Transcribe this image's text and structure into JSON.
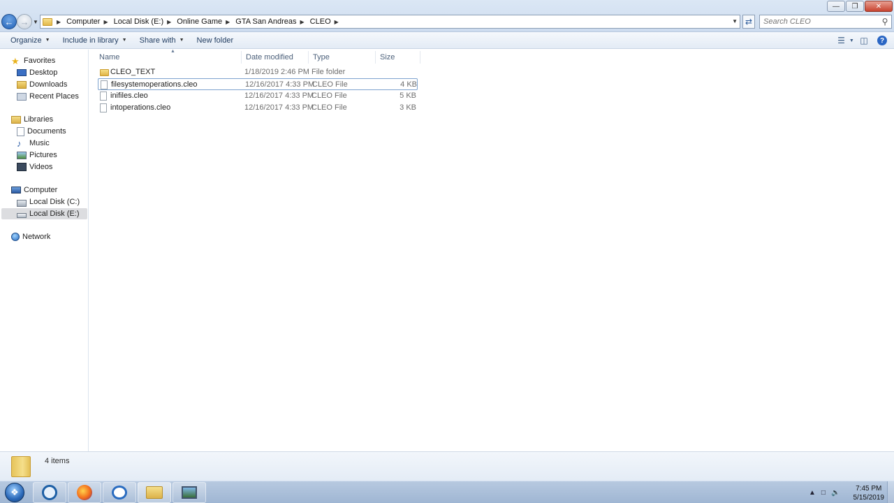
{
  "address": {
    "crumbs": [
      "Computer",
      "Local Disk (E:)",
      "Online Game",
      "GTA San Andreas",
      "CLEO"
    ]
  },
  "search": {
    "placeholder": "Search CLEO"
  },
  "toolbar": {
    "organize": "Organize",
    "include_in_library": "Include in library",
    "share_with": "Share with",
    "new_folder": "New folder"
  },
  "nav": {
    "favorites": "Favorites",
    "desktop": "Desktop",
    "downloads": "Downloads",
    "recent_places": "Recent Places",
    "libraries": "Libraries",
    "documents": "Documents",
    "music": "Music",
    "pictures": "Pictures",
    "videos": "Videos",
    "computer": "Computer",
    "local_disk_c": "Local Disk (C:)",
    "local_disk_e": "Local Disk (E:)",
    "network": "Network"
  },
  "columns": {
    "name": "Name",
    "date": "Date modified",
    "type": "Type",
    "size": "Size"
  },
  "files": [
    {
      "name": "CLEO_TEXT",
      "date": "1/18/2019 2:46 PM",
      "type": "File folder",
      "size": ""
    },
    {
      "name": "filesystemoperations.cleo",
      "date": "12/16/2017 4:33 PM",
      "type": "CLEO File",
      "size": "4 KB"
    },
    {
      "name": "inifiles.cleo",
      "date": "12/16/2017 4:33 PM",
      "type": "CLEO File",
      "size": "5 KB"
    },
    {
      "name": "intoperations.cleo",
      "date": "12/16/2017 4:33 PM",
      "type": "CLEO File",
      "size": "3 KB"
    }
  ],
  "status": {
    "count": "4 items"
  },
  "clock": {
    "time": "7:45 PM",
    "date": "5/15/2019"
  }
}
